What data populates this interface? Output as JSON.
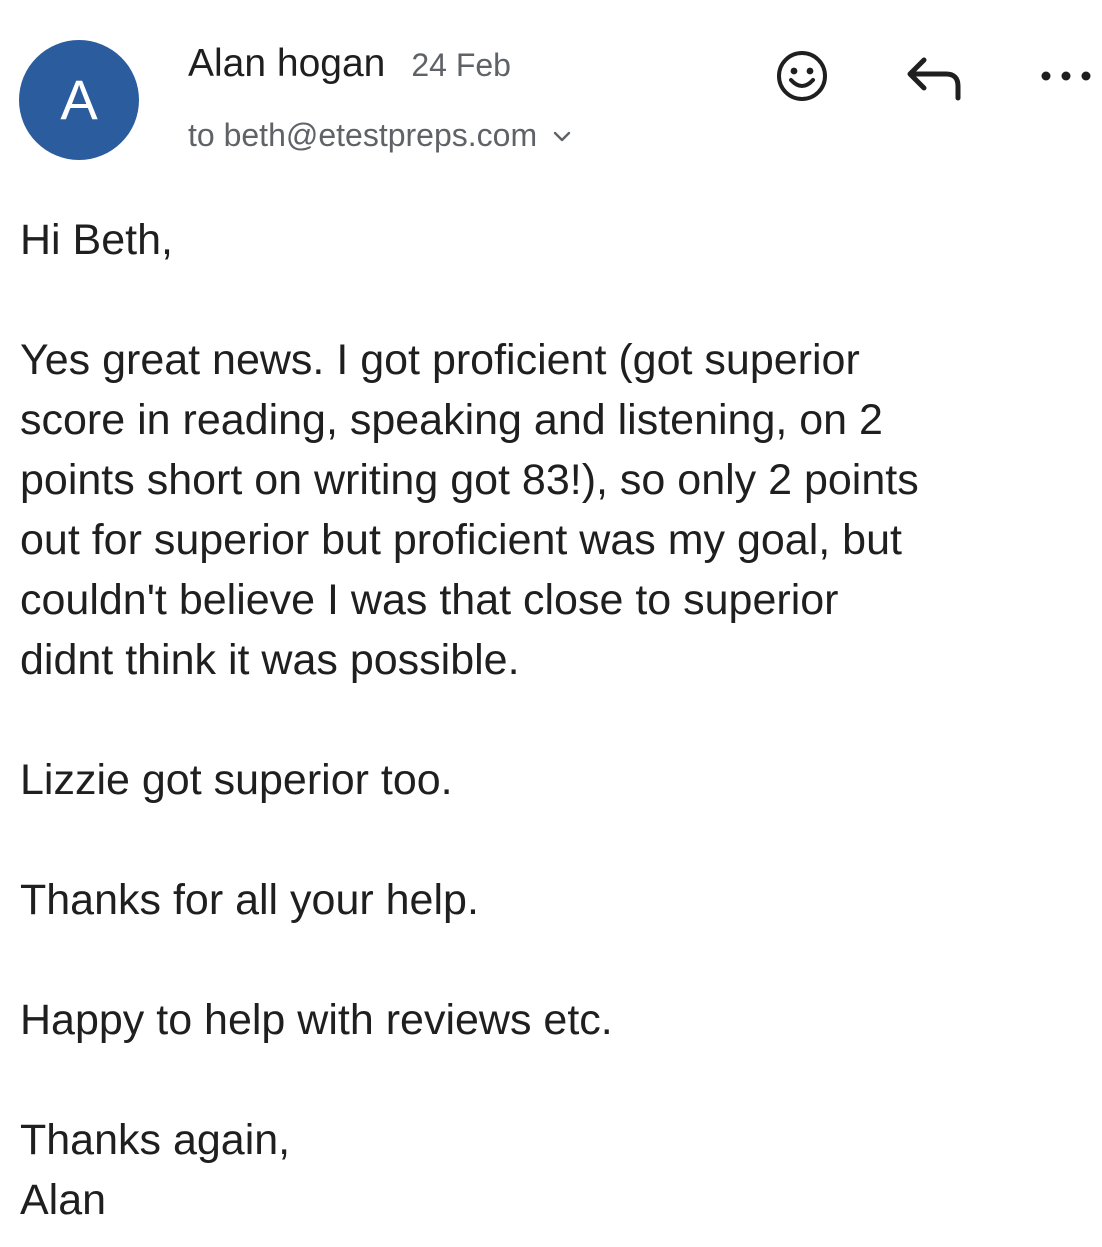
{
  "sender": {
    "avatar_letter": "A",
    "avatar_color": "#2a5c9e",
    "name": "Alan hogan",
    "date": "24 Feb",
    "recipient": "to beth@etestpreps.com"
  },
  "actions": {
    "icons": [
      "smiley-icon",
      "reply-icon",
      "more-options-icon",
      "chevron-down-icon"
    ]
  },
  "message": {
    "greeting": "Hi Beth,",
    "paragraph1_lines": [
      "Yes great news. I got proficient (got superior",
      "score in reading, speaking and listening, on 2",
      "points short on writing got 83!), so only 2 points",
      "out for superior but proficient was my goal, but",
      "couldn't believe I was that close to superior",
      "didnt think it was possible."
    ],
    "paragraph2": "Lizzie got superior too.",
    "paragraph3": "Thanks for all your help.",
    "paragraph4": "Happy to help with reviews etc.",
    "signoff": "Thanks again,",
    "signature": "Alan"
  }
}
